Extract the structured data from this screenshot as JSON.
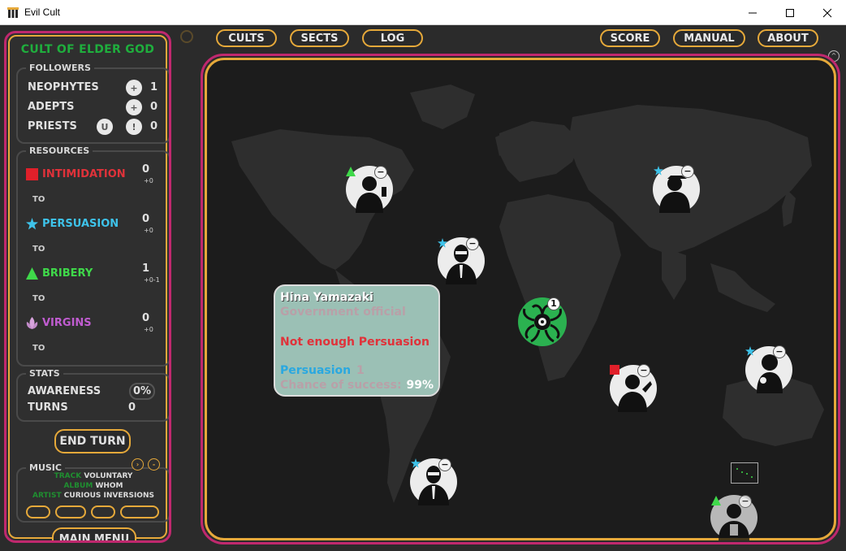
{
  "window": {
    "title": "Evil Cult"
  },
  "panel": {
    "cult_name": "CULT OF ELDER GOD",
    "followers": {
      "label": "FOLLOWERS",
      "items": [
        {
          "name": "NEOPHYTES",
          "value": "1",
          "buttons": [
            "+"
          ]
        },
        {
          "name": "ADEPTS",
          "value": "0",
          "buttons": [
            "+"
          ]
        },
        {
          "name": "PRIESTS",
          "value": "0",
          "buttons": [
            "U",
            "!"
          ]
        }
      ]
    },
    "resources": {
      "label": "RESOURCES",
      "to_label": "TO",
      "items": [
        {
          "name": "INTIMIDATION",
          "value": "0",
          "delta": "+0",
          "color": "#e0323a",
          "icon": "red-square-icon"
        },
        {
          "name": "PERSUASION",
          "value": "0",
          "delta": "+0",
          "color": "#3ec3ea",
          "icon": "blue-star-icon"
        },
        {
          "name": "BRIBERY",
          "value": "1",
          "delta": "+0-1",
          "color": "#3fd94a",
          "icon": "green-triangle-icon"
        },
        {
          "name": "VIRGINS",
          "value": "0",
          "delta": "+0",
          "color": "#c05cd0",
          "icon": "pink-lotus-icon"
        }
      ]
    },
    "stats": {
      "label": "STATS",
      "awareness_label": "AWARENESS",
      "awareness_value": "0%",
      "turns_label": "TURNS",
      "turns_value": "0"
    },
    "end_turn": "END TURN",
    "music": {
      "label": "MUSIC",
      "track_label": "TRACK",
      "track": "VOLUNTARY",
      "album_label": "ALBUM",
      "album": "WHOM",
      "artist_label": "ARTIST",
      "artist": "CURIOUS INVERSIONS"
    },
    "main_menu": "MAIN MENU"
  },
  "nav": {
    "left": [
      "CULTS",
      "SECTS",
      "LOG"
    ],
    "right": [
      "SCORE",
      "MANUAL",
      "ABOUT"
    ]
  },
  "map": {
    "center_badge": "1",
    "tooltip": {
      "name": "Hina Yamazaki",
      "role": "Government official",
      "warning": "Not enough Persuasion",
      "requirement_label": "Persuasion",
      "requirement_value": "1",
      "chance_label": "Chance of success:",
      "chance_value": "99%"
    }
  },
  "colors": {
    "frame_pink": "#c0286e",
    "frame_gold": "#e6a93a",
    "cult_green": "#1fae3d"
  }
}
